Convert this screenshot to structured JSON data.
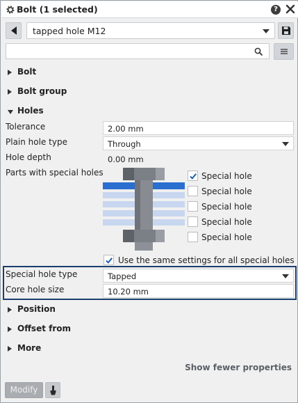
{
  "window": {
    "title": "Bolt (1 selected)"
  },
  "header": {
    "preset": "tapped hole M12",
    "search_placeholder": ""
  },
  "sections": {
    "bolt": "Bolt",
    "bolt_group": "Bolt group",
    "holes": "Holes",
    "position": "Position",
    "offset_from": "Offset from",
    "more": "More"
  },
  "holes": {
    "tolerance_label": "Tolerance",
    "tolerance_value": "2.00 mm",
    "plain_hole_type_label": "Plain hole type",
    "plain_hole_type_value": "Through",
    "hole_depth_label": "Hole depth",
    "hole_depth_value": "0.00 mm",
    "parts_label": "Parts with special holes",
    "special_holes": [
      {
        "label": "Special hole",
        "checked": true
      },
      {
        "label": "Special hole",
        "checked": false
      },
      {
        "label": "Special hole",
        "checked": false
      },
      {
        "label": "Special hole",
        "checked": false
      },
      {
        "label": "Special hole",
        "checked": false
      }
    ],
    "same_settings_label": "Use the same settings for all special holes",
    "same_settings_checked": true,
    "special_hole_type_label": "Special hole type",
    "special_hole_type_value": "Tapped",
    "core_hole_size_label": "Core hole size",
    "core_hole_size_value": "10.20 mm"
  },
  "footer": {
    "show_fewer": "Show fewer properties",
    "modify": "Modify"
  },
  "colors": {
    "accent_blue": "#2a6fd0",
    "highlight_border": "#1a3e6e",
    "plate_light": "#c8d6ef"
  }
}
